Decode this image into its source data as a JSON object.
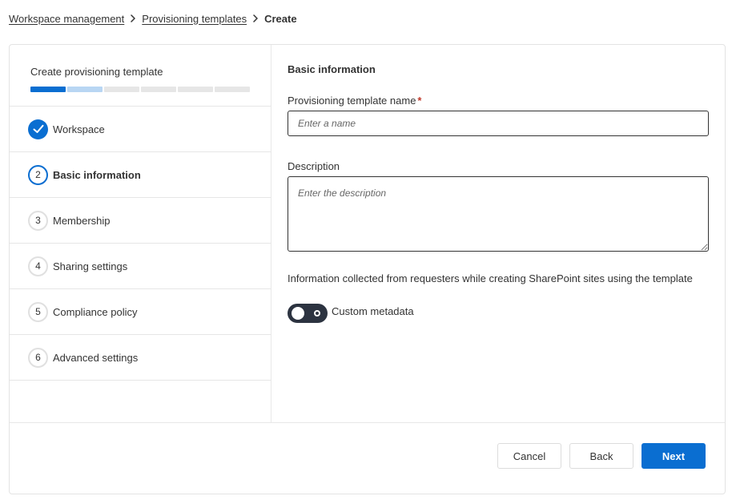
{
  "breadcrumb": {
    "items": [
      {
        "label": "Workspace management"
      },
      {
        "label": "Provisioning templates"
      }
    ],
    "current": "Create"
  },
  "stepper": {
    "title": "Create provisioning template",
    "progress": {
      "total_segments": 6,
      "completed": 1,
      "current_step": 2
    },
    "steps": [
      {
        "number": "1",
        "label": "Workspace",
        "status": "done"
      },
      {
        "number": "2",
        "label": "Basic information",
        "status": "current"
      },
      {
        "number": "3",
        "label": "Membership",
        "status": "pending"
      },
      {
        "number": "4",
        "label": "Sharing settings",
        "status": "pending"
      },
      {
        "number": "5",
        "label": "Compliance policy",
        "status": "pending"
      },
      {
        "number": "6",
        "label": "Advanced settings",
        "status": "pending"
      }
    ]
  },
  "form": {
    "section_title": "Basic information",
    "name_label": "Provisioning template name",
    "required_mark": "*",
    "name_placeholder": "Enter a name",
    "name_value": "",
    "description_label": "Description",
    "description_placeholder": "Enter the description",
    "description_value": "",
    "info_text": "Information collected from requesters while creating SharePoint sites using the template",
    "toggle": {
      "label": "Custom metadata",
      "state": "off"
    }
  },
  "footer": {
    "cancel_label": "Cancel",
    "back_label": "Back",
    "next_label": "Next"
  },
  "colors": {
    "accent": "#0a6ed1",
    "accent_light": "#b8d6f3",
    "toggle_track": "#2c3340",
    "required": "#c0392b"
  }
}
